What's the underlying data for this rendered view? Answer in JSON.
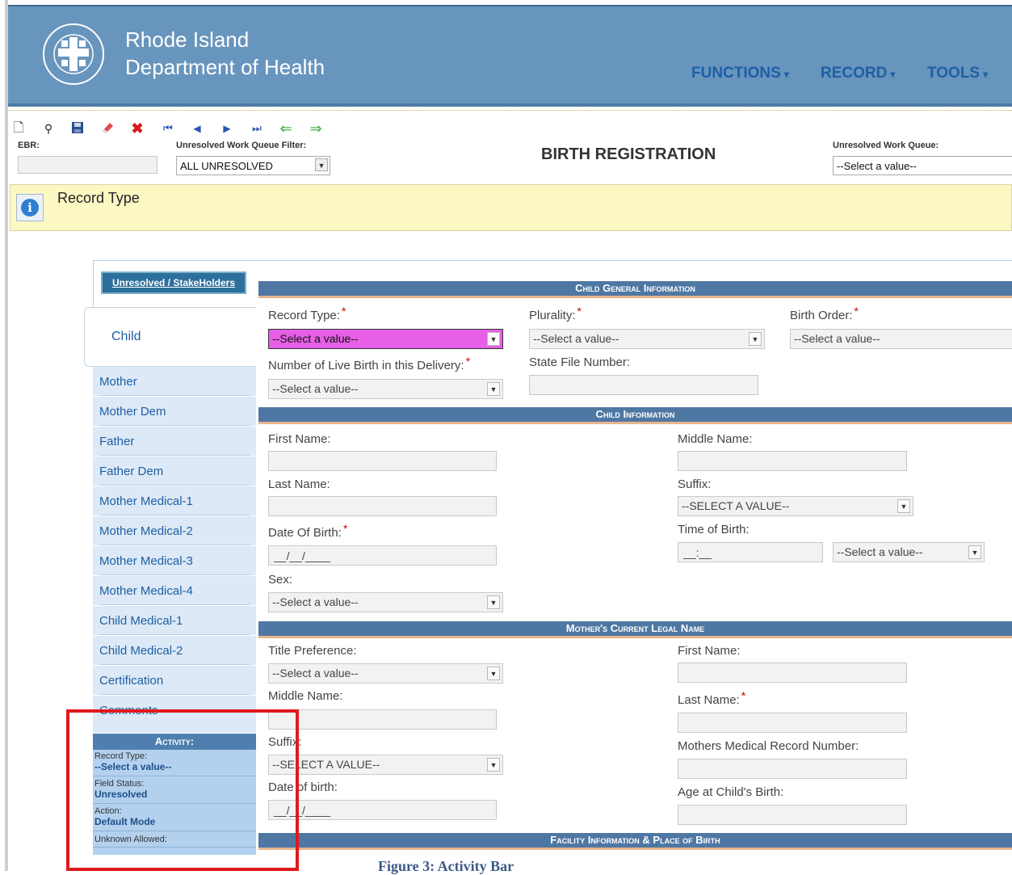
{
  "header": {
    "org_line1": "Rhode Island",
    "org_line2": "Department of Health",
    "menu": [
      {
        "label": "FUNCTIONS"
      },
      {
        "label": "RECORD"
      },
      {
        "label": "TOOLS"
      }
    ]
  },
  "toolbar": {
    "icons": [
      "new-icon",
      "binoculars-icon",
      "save-icon",
      "eraser-icon",
      "delete-icon",
      "first-icon",
      "previous-icon",
      "next-icon",
      "last-icon",
      "back-arrow-icon",
      "forward-arrow-icon"
    ],
    "ebr_label": "EBR:",
    "ebr_value": "",
    "filter_label": "Unresolved Work Queue Filter:",
    "filter_value": "ALL UNRESOLVED",
    "page_title": "BIRTH REGISTRATION",
    "queue_label": "Unresolved Work Queue:",
    "queue_value": "--Select a value--"
  },
  "infobar": {
    "text": "Record Type"
  },
  "sidebar": {
    "stakeholders_button": "Unresolved / StakeHolders",
    "active_tab": "Child",
    "items": [
      "Mother",
      "Mother Dem",
      "Father",
      "Father Dem",
      "Mother Medical-1",
      "Mother Medical-2",
      "Mother Medical-3",
      "Mother Medical-4",
      "Child Medical-1",
      "Child Medical-2",
      "Certification",
      "Comments"
    ]
  },
  "activity": {
    "title": "Activity:",
    "record_type_label": "Record Type:",
    "record_type_value": "--Select a value--",
    "field_status_label": "Field Status:",
    "field_status_value": "Unresolved",
    "action_label": "Action:",
    "action_value": "Default Mode",
    "unknown_label": "Unknown Allowed:"
  },
  "sections": {
    "child_general": "Child General Information",
    "child_info": "Child Information",
    "mother_name": "Mother's Current Legal Name",
    "facility": "Facility Information & Place of Birth"
  },
  "form": {
    "record_type_label": "Record Type:",
    "record_type_value": "--Select a value--",
    "plurality_label": "Plurality:",
    "plurality_value": "--Select a value--",
    "birth_order_label": "Birth Order:",
    "birth_order_value": "--Select a value--",
    "live_birth_label": "Number of Live Birth in this Delivery:",
    "live_birth_value": "--Select a value--",
    "state_file_label": "State File Number:",
    "first_name_label": "First Name:",
    "middle_name_label": "Middle Name:",
    "last_name_label": "Last Name:",
    "suffix_label": "Suffix:",
    "suffix_value": "--SELECT A VALUE--",
    "dob_label": "Date Of Birth:",
    "dob_value": "__/__/____",
    "tob_label": "Time of Birth:",
    "tob_value": "__:__",
    "tob_ampm_value": "--Select a value--",
    "sex_label": "Sex:",
    "sex_value": "--Select a value--",
    "m_title_label": "Title Preference:",
    "m_title_value": "--Select a value--",
    "m_first_label": "First Name:",
    "m_middle_label": "Middle Name:",
    "m_last_label": "Last Name:",
    "m_suffix_label": "Suffix:",
    "m_suffix_value": "--SELECT A VALUE--",
    "m_mrn_label": "Mothers Medical Record Number:",
    "m_dob_label": "Date of birth:",
    "m_dob_value": "__/__/____",
    "m_age_label": "Age at Child's Birth:"
  },
  "caption": "Figure 3: Activity Bar",
  "colors": {
    "header_bg": "#6895bd",
    "nav_link": "#1d5fa5",
    "section_header": "#4f77a3",
    "required_field_highlight": "#e65fe6",
    "annotation_box": "#e0191d"
  }
}
